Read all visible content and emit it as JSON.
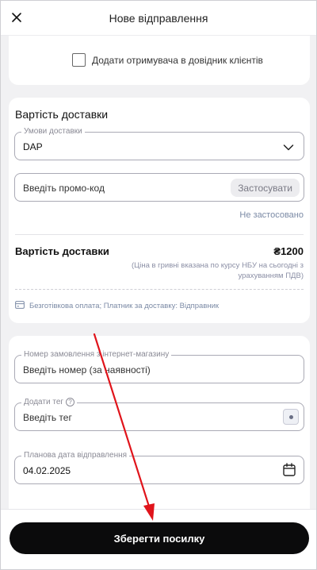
{
  "header": {
    "title": "Нове відправлення",
    "close_icon": "close-icon"
  },
  "recipient": {
    "checkbox_label": "Додати отримувача в довідник клієнтів",
    "checked": false
  },
  "delivery_cost": {
    "section_title": "Вартість доставки",
    "terms": {
      "label": "Умови доставки",
      "value": "DAP"
    },
    "promo": {
      "placeholder": "Введіть промо-код",
      "apply_label": "Застосувати",
      "status": "Не застосовано"
    },
    "total": {
      "label": "Вартість доставки",
      "value": "₴1200",
      "note": "(Ціна в гривні вказана по курсу НБУ на сьогодні з урахуванням ПДВ)"
    },
    "payment_info": "Безготівкова оплата; Платник за доставку: Відправник"
  },
  "order": {
    "order_number": {
      "label": "Номер замовлення з інтернет-магазину",
      "placeholder": "Введіть номер (за наявності)"
    },
    "tag": {
      "label": "Додати тег",
      "help": "?",
      "placeholder": "Введіть тег"
    },
    "ship_date": {
      "label": "Планова дата відправлення",
      "value": "04.02.2025"
    }
  },
  "footer": {
    "save_label": "Зберегти посилку"
  },
  "colors": {
    "primary_button": "#0b0b0c",
    "annotation_arrow": "#e0141b",
    "muted_link": "#7b8aa5"
  }
}
